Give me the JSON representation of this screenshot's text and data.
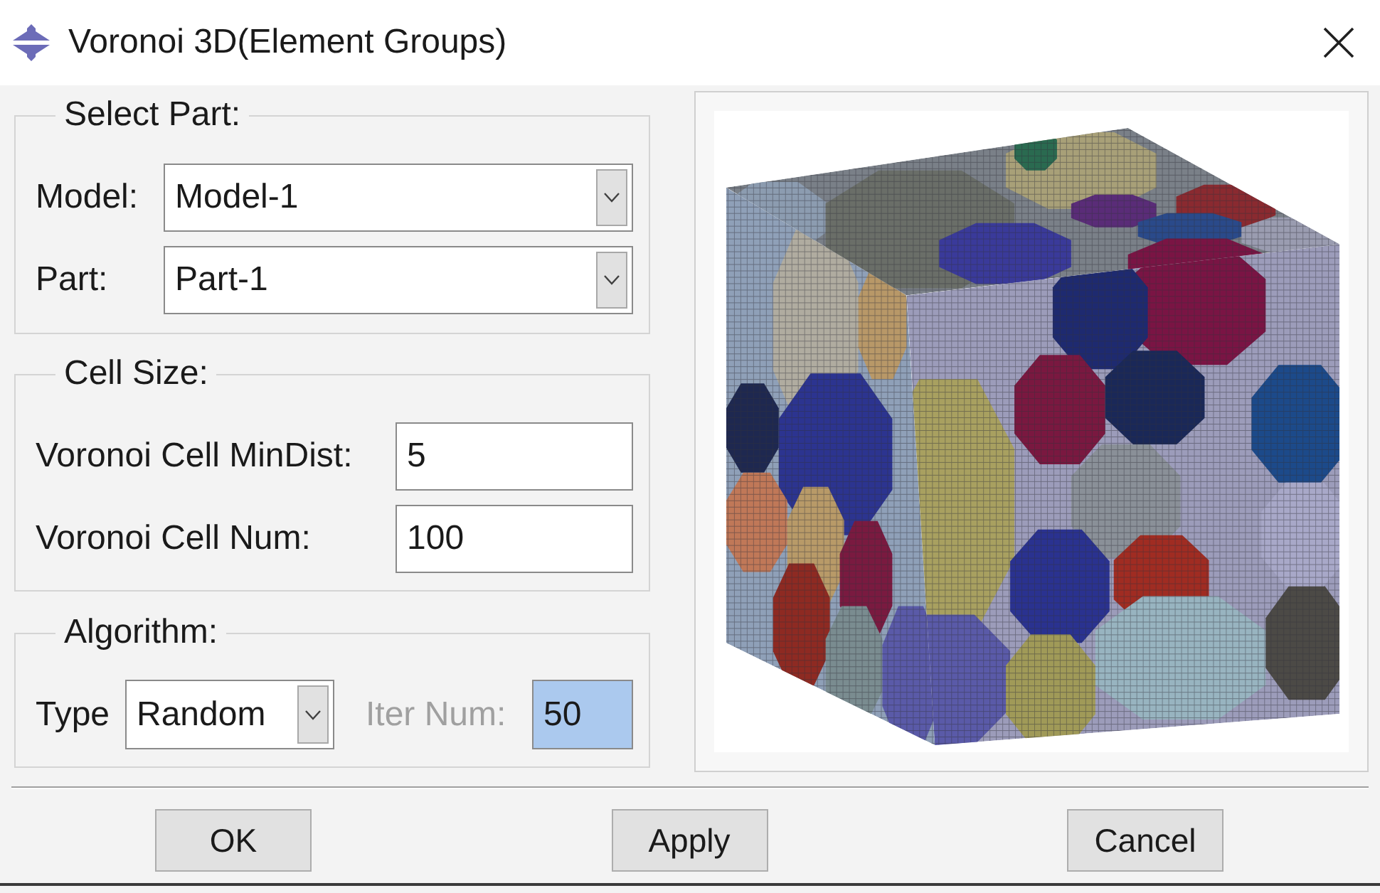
{
  "window": {
    "title": "Voronoi 3D(Element Groups)"
  },
  "select_part": {
    "title": "Select Part:",
    "fields": [
      {
        "label": "Model:",
        "value": "Model-1"
      },
      {
        "label": "Part:",
        "value": "Part-1"
      }
    ]
  },
  "cell_size": {
    "title": "Cell Size:",
    "fields": [
      {
        "label": "Voronoi Cell MinDist:",
        "value": "5"
      },
      {
        "label": "Voronoi Cell Num:",
        "value": "100"
      }
    ]
  },
  "algorithm": {
    "title": "Algorithm:",
    "type": {
      "label": "Type",
      "value": "Random"
    },
    "iter_num": {
      "label": "Iter Num:",
      "value": "50",
      "disabled": true,
      "highlighted": true
    }
  },
  "buttons": [
    {
      "label": "OK"
    },
    {
      "label": "Apply"
    },
    {
      "label": "Cancel"
    }
  ]
}
